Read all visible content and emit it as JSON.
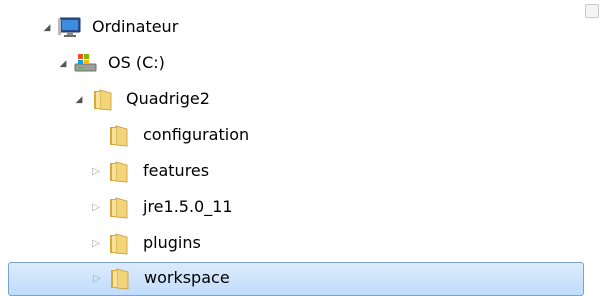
{
  "tree": {
    "computer": {
      "label": "Ordinateur",
      "icon": "computer-icon",
      "state": "expanded"
    },
    "drive": {
      "label": "OS (C:)",
      "icon": "drive-icon",
      "state": "expanded"
    },
    "root_folder": {
      "label": "Quadrige2",
      "icon": "folder-icon",
      "state": "expanded"
    },
    "children": [
      {
        "label": "configuration",
        "icon": "folder-icon",
        "state": "leaf"
      },
      {
        "label": "features",
        "icon": "folder-icon",
        "state": "collapsed"
      },
      {
        "label": "jre1.5.0_11",
        "icon": "folder-icon",
        "state": "collapsed"
      },
      {
        "label": "plugins",
        "icon": "folder-icon",
        "state": "collapsed"
      },
      {
        "label": "workspace",
        "icon": "folder-icon",
        "state": "collapsed",
        "selected": true
      }
    ]
  },
  "colors": {
    "selection_fill": "#cce3fc",
    "selection_border": "#7da2ce",
    "folder": "#e8c55a"
  }
}
